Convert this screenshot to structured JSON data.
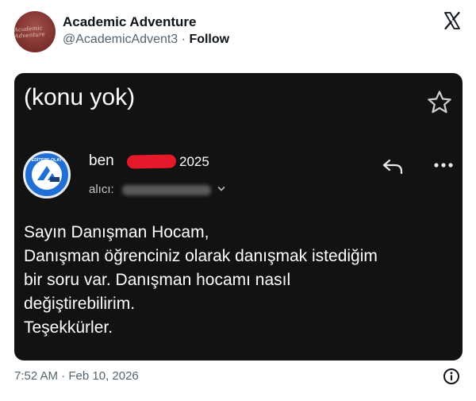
{
  "tweet": {
    "author_name": "Academic Adventure",
    "handle": "@AcademicAdvent3",
    "separator": "·",
    "follow_label": "Follow",
    "avatar_text": "Academic Adventure",
    "timestamp": "7:52 AM · Feb 10, 2026"
  },
  "email": {
    "subject": "(konu yok)",
    "sender": "ben",
    "year": "2025",
    "recipient_label": "alıcı:",
    "badge_text": "YEDİTEPE OLAYY",
    "body_lines": [
      "Sayın Danışman Hocam,",
      "Danışman öğrenciniz olarak danışmak istediğim",
      "bir soru var. Danışman hocamı nasıl",
      "değiştirebilirim.",
      "Teşekkürler."
    ]
  },
  "icons": {
    "x_logo": "x-logo-icon",
    "star": "star-icon",
    "reply": "reply-icon",
    "more": "more-icon",
    "chevron": "chevron-down-icon",
    "info": "info-icon"
  },
  "colors": {
    "card_bg": "#121212",
    "redaction": "#e6192a",
    "muted_text": "#536471",
    "badge_blue": "#1f6fd6"
  }
}
